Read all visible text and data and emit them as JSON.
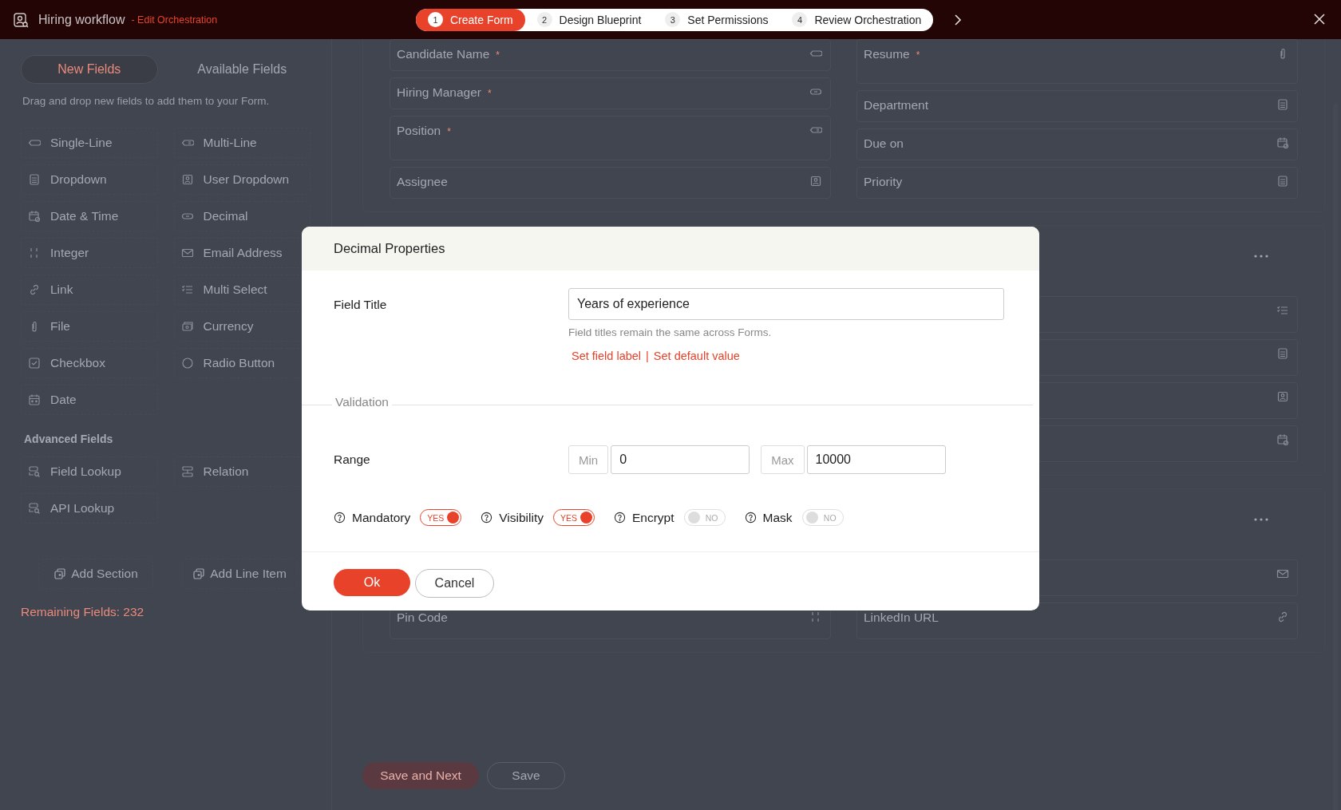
{
  "header": {
    "title": "Hiring workflow",
    "subtitle": "- Edit Orchestration"
  },
  "steps": [
    {
      "number": "1",
      "label": "Create Form",
      "selected": true
    },
    {
      "number": "2",
      "label": "Design Blueprint",
      "selected": false
    },
    {
      "number": "3",
      "label": "Set Permissions",
      "selected": false
    },
    {
      "number": "4",
      "label": "Review Orchestration",
      "selected": false
    }
  ],
  "field_panel": {
    "tabs": [
      {
        "label": "New Fields",
        "selected": true
      },
      {
        "label": "Available Fields",
        "selected": false
      }
    ],
    "hint": "Drag and drop new fields to add them to your Form.",
    "fields": [
      {
        "label": "Single-Line",
        "kind": "single-line"
      },
      {
        "label": "Multi-Line",
        "kind": "multi-line"
      },
      {
        "label": "Dropdown",
        "kind": "dropdown"
      },
      {
        "label": "User Dropdown",
        "kind": "user"
      },
      {
        "label": "Date & Time",
        "kind": "date-time"
      },
      {
        "label": "Decimal",
        "kind": "decimal"
      },
      {
        "label": "Integer",
        "kind": "integer"
      },
      {
        "label": "Email Address",
        "kind": "email"
      },
      {
        "label": "Link",
        "kind": "link"
      },
      {
        "label": "Multi Select",
        "kind": "multi-select"
      },
      {
        "label": "File",
        "kind": "file"
      },
      {
        "label": "Currency",
        "kind": "currency"
      },
      {
        "label": "Checkbox",
        "kind": "checkbox"
      },
      {
        "label": "Radio Button",
        "kind": "radio"
      },
      {
        "label": "Date",
        "kind": "date"
      }
    ],
    "advanced_heading": "Advanced Fields",
    "advanced_fields": [
      {
        "label": "Field Lookup",
        "kind": "field-lookup"
      },
      {
        "label": "Relation",
        "kind": "relation"
      },
      {
        "label": "API Lookup",
        "kind": "api-lookup"
      }
    ],
    "actions": [
      "Add Section",
      "Add Line Item"
    ],
    "remaining": "Remaining Fields: 232"
  },
  "form": {
    "sections": [
      {
        "menu": false,
        "left": [
          {
            "label": "Candidate Name",
            "required_mark": "*",
            "kind": "single-line"
          },
          {
            "label": "Hiring Manager",
            "required_mark": "*",
            "kind": "decimal"
          },
          {
            "label": "Position",
            "required_mark": "*",
            "kind": "multi-line"
          },
          {
            "label": "Assignee",
            "kind": "user"
          }
        ],
        "right": [
          {
            "label": "Resume",
            "required_mark": "*",
            "kind": "file"
          },
          {
            "label": "Department",
            "kind": "dropdown"
          },
          {
            "label": "Due on",
            "kind": "date-time"
          },
          {
            "label": "Priority",
            "kind": "dropdown"
          }
        ]
      },
      {
        "menu": true,
        "right": [
          {
            "kind": "multi-select"
          },
          {
            "kind": "dropdown"
          },
          {
            "kind": "user"
          },
          {
            "kind": "date-time"
          }
        ]
      },
      {
        "menu": true,
        "left": [
          {
            "label": "Pin Code",
            "kind": "integer"
          }
        ],
        "right": [
          {
            "kind": "email"
          },
          {
            "label": "LinkedIn URL",
            "kind": "link"
          }
        ]
      }
    ],
    "buttons": [
      "Save and Next",
      "Save"
    ]
  },
  "dialog": {
    "title": "Decimal Properties",
    "field_title_label": "Field Title",
    "field_title_value": "Years of experience",
    "hint": "Field titles remain the same across Forms.",
    "links": [
      "Set field label",
      "Set default value"
    ],
    "link_separator": "|",
    "validation_legend": "Validation",
    "range_label": "Range",
    "min_label": "Min",
    "min_value": "0",
    "max_label": "Max",
    "max_value": "10000",
    "toggles": [
      {
        "label": "Mandatory",
        "on": true,
        "text": "YES"
      },
      {
        "label": "Visibility",
        "on": true,
        "text": "YES"
      },
      {
        "label": "Encrypt",
        "on": false,
        "text": "NO"
      },
      {
        "label": "Mask",
        "on": false,
        "text": "NO"
      }
    ],
    "ok": "Ok",
    "cancel": "Cancel"
  }
}
